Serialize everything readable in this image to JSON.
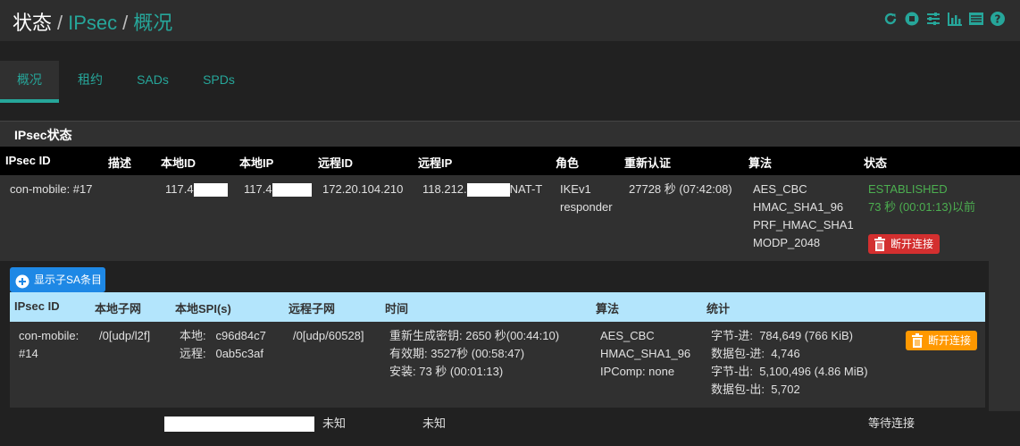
{
  "breadcrumb": {
    "part0": "状态",
    "sep": "/",
    "part1": "IPsec",
    "part2": "概况"
  },
  "header_icons": [
    "reload-icon",
    "stop-icon",
    "sliders-icon",
    "bar-chart-icon",
    "list-icon",
    "help-icon"
  ],
  "tabs": [
    {
      "label": "概况",
      "active": true
    },
    {
      "label": "租约",
      "active": false
    },
    {
      "label": "SADs",
      "active": false
    },
    {
      "label": "SPDs",
      "active": false
    }
  ],
  "panel": {
    "title": "IPsec状态"
  },
  "table": {
    "columns": [
      "IPsec ID",
      "描述",
      "本地ID",
      "本地IP",
      "远程ID",
      "远程IP",
      "角色",
      "重新认证",
      "算法",
      "状态"
    ],
    "row": {
      "ipsec_id": "con-mobile: #17",
      "local_id": "117.4",
      "local_ip": "117.4",
      "remote_id": "172.20.104.210",
      "remote_ip_prefix": "118.212.",
      "remote_ip_suffix": "NAT-T",
      "role_line1": "IKEv1",
      "role_line2": "responder",
      "reauth": "27728 秒 (07:42:08)",
      "algo": [
        "AES_CBC",
        "HMAC_SHA1_96",
        "PRF_HMAC_SHA1",
        "MODP_2048"
      ],
      "status": "ESTABLISHED",
      "status_time": "73 秒 (00:01:13)以前",
      "disconnect_label": "断开连接"
    }
  },
  "child": {
    "show_button": "显示子SA条目",
    "columns": [
      "IPsec ID",
      "本地子网",
      "本地SPI(s)",
      "远程子网",
      "时间",
      "算法",
      "统计"
    ],
    "row": {
      "id_line1": "con-mobile:",
      "id_line2": "#14",
      "local_subnet": "/0[udp/l2f]",
      "spi_local_label": "本地:",
      "spi_local": "c96d84c7",
      "spi_remote_label": "远程:",
      "spi_remote": "0ab5c3af",
      "remote_subnet": "/0[udp/60528]",
      "time": [
        "重新生成密钥: 2650 秒(00:44:10)",
        "有效期: 3527秒 (00:58:47)",
        "安装: 73 秒 (00:01:13)"
      ],
      "algo": [
        "AES_CBC",
        "HMAC_SHA1_96",
        "IPComp: none"
      ],
      "stats": [
        {
          "label": "字节-进:",
          "value": "784,649 (766 KiB)"
        },
        {
          "label": "数据包-进:",
          "value": "4,746"
        },
        {
          "label": "字节-出:",
          "value": "5,100,496 (4.86 MiB)"
        },
        {
          "label": "数据包-出:",
          "value": "5,702"
        }
      ],
      "disconnect_label": "断开连接"
    }
  },
  "last_row": {
    "col1": "未知",
    "col2": "未知",
    "status": "等待连接"
  },
  "colors": {
    "accent": "#26a69a",
    "header_bg": "#000000",
    "child_header_bg": "#b3e5fc",
    "danger": "#d32f2f",
    "warning": "#ff9800",
    "primary": "#1e88e5",
    "success": "#4caf50"
  }
}
